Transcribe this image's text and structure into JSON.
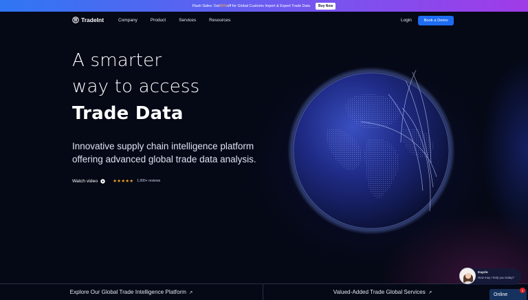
{
  "promo": {
    "text_before": "Flash Sales: Get ",
    "accent": "30%",
    "text_after": " off for Global Customs Import & Export Trade Data",
    "button": "Buy Now"
  },
  "nav": {
    "logo": "TradeInt",
    "links": [
      "Company",
      "Product",
      "Services",
      "Resources"
    ],
    "login": "Login",
    "demo": "Book a Demo"
  },
  "hero": {
    "line1": "A smarter",
    "line2": "way to access",
    "line3": "Trade Data",
    "subtitle": "Innovative supply chain intelligence platform offering advanced global trade data analysis.",
    "watch_video": "Watch video",
    "stars": "★★★★★",
    "rating_value": 5,
    "reviews": "1,000+ reviews"
  },
  "bottom": {
    "explore": "Explore Our Global Trade Intelligence Platform",
    "services": "Valued-Added Trade Global Services",
    "arrow": "↗"
  },
  "chat": {
    "name": "Kayris",
    "message": "How may I help you today?",
    "status": "Online",
    "unread": "1"
  },
  "colors": {
    "accent_blue": "#1e6cf2",
    "promo_accent": "#ffb13a",
    "star": "#f5a623",
    "background": "#050815"
  },
  "icons": [
    "tradeint-logo-icon",
    "play-icon",
    "star-icon",
    "arrow-up-right-icon",
    "globe-image"
  ]
}
